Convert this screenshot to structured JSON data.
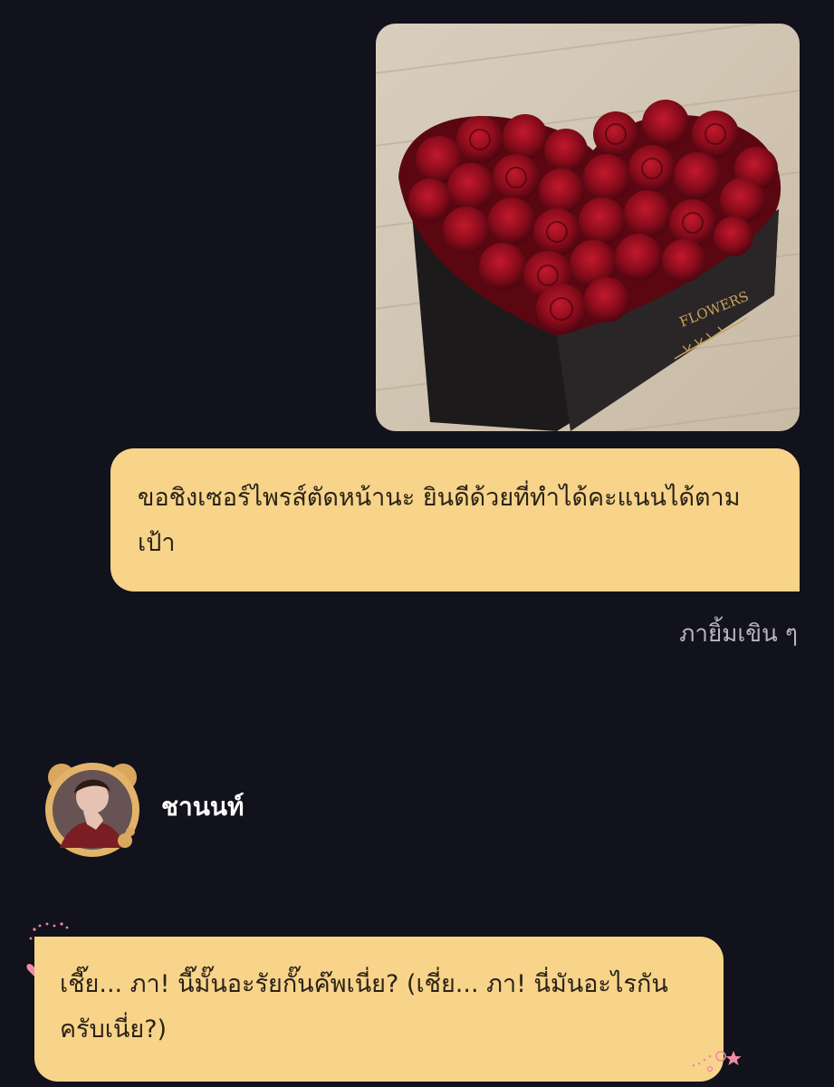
{
  "messages": {
    "photo": {
      "icon": "rose-heart-box-photo",
      "box_text": "FLOWERS"
    },
    "outgoing_text": "ขอชิงเซอร์ไพรส์ตัดหน้านะ ยินดีด้วยที่ทำได้คะแนนได้ตามเป้า",
    "caption": "ภายิ้มเขิน ๆ",
    "sender": {
      "name": "ชานนท์",
      "avatar_icon": "avatar-icon"
    },
    "incoming_text": "เชี๊ย... ภา! นี๊มั๊นอะรัยกั๊นค๊พเนี่ย? (เชี่ย... ภา! นี่มันอะไรกันครับเนี่ย?)"
  },
  "colors": {
    "background": "#12121c",
    "bubble": "#f7d48a",
    "bubble_text": "#2b2218",
    "caption_text": "#b8b6bf",
    "name_text": "#ffffff",
    "decoration_pink": "#f08aa6"
  }
}
